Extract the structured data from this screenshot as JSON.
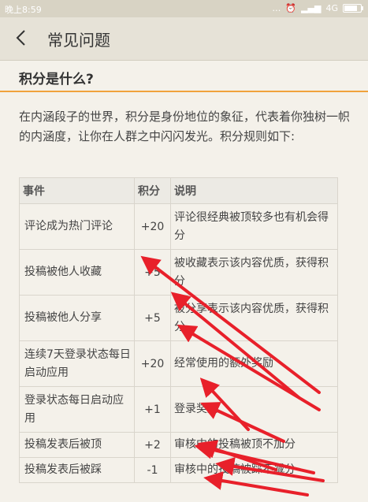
{
  "status_bar": {
    "time": "晚上8:59",
    "network": "4G",
    "icons": [
      "more-icon",
      "alarm-icon",
      "signal-icon",
      "battery-icon"
    ],
    "battery_level": 0.8
  },
  "nav": {
    "back_icon": "chevron-left-icon",
    "title": "常见问题"
  },
  "section": {
    "heading": "积分是什么?"
  },
  "intro_text": "在内涵段子的世界，积分是身份地位的象征，代表着你独树一帜的内涵度，让你在人群之中闪闪发光。积分规则如下:",
  "table": {
    "headers": [
      "事件",
      "积分",
      "说明"
    ],
    "rows": [
      {
        "event": "评论成为热门评论",
        "points": "+20",
        "desc": "评论很经典被顶较多也有机会得分"
      },
      {
        "event": "投稿被他人收藏",
        "points": "+5",
        "desc": "被收藏表示该内容优质，获得积分"
      },
      {
        "event": "投稿被他人分享",
        "points": "+5",
        "desc": "被分享表示该内容优质，获得积分"
      },
      {
        "event": "连续7天登录状态每日启动应用",
        "points": "+20",
        "desc": "经常使用的额外奖励"
      },
      {
        "event": "登录状态每日启动应用",
        "points": "+1",
        "desc": "登录奖励"
      },
      {
        "event": "投稿发表后被顶",
        "points": "+2",
        "desc": "审核中的投稿被顶不加分"
      },
      {
        "event": "投稿发表后被踩",
        "points": "-1",
        "desc": "审核中的投稿被踩不减分"
      }
    ]
  },
  "annotation_color": "#e8202a"
}
